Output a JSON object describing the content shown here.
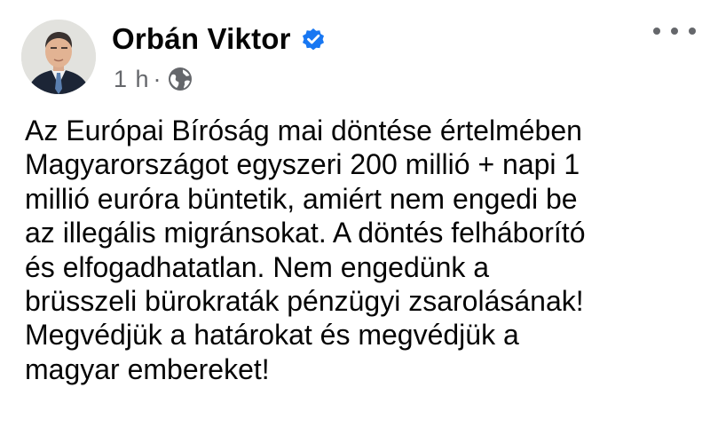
{
  "author": {
    "name": "Orbán Viktor",
    "verified": true,
    "avatar": "profile-photo",
    "verified_icon": "verified-badge-icon",
    "badge_color": "#1877f2"
  },
  "meta": {
    "timestamp": "1 h",
    "separator": "·",
    "audience_icon": "globe-icon"
  },
  "menu": {
    "icon": "more-options-icon"
  },
  "post": {
    "lines": [
      "Az Európai Bíróság mai döntése értelmében",
      "Magyarországot egyszeri 200 millió + napi 1",
      "millió euróra büntetik, amiért nem engedi be",
      "az illegális migránsokat. A döntés felháborító",
      "és elfogadhatatlan. Nem engedünk a",
      "brüsszeli bürokraták pénzügyi zsarolásának!",
      "Megvédjük a határokat és megvédjük a",
      "magyar embereket!"
    ]
  },
  "colors": {
    "text": "#050505",
    "secondary": "#65676b",
    "background": "#ffffff"
  }
}
